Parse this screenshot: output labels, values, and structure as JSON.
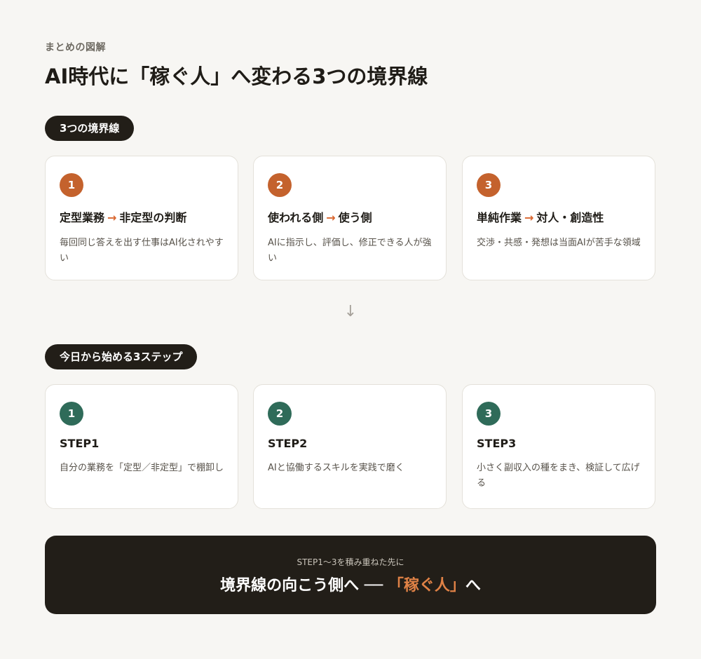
{
  "header": {
    "kicker": "まとめの図解",
    "title": "AI時代に「稼ぐ人」へ変わる3つの境界線"
  },
  "section1": {
    "label": "3つの境界線",
    "arrow": "→",
    "cards": [
      {
        "number": "1",
        "from": "定型業務",
        "to": "非定型の判断",
        "desc": "毎回同じ答えを出す仕事はAI化されやすい"
      },
      {
        "number": "2",
        "from": "使われる側",
        "to": "使う側",
        "desc": "AIに指示し、評価し、修正できる人が強い"
      },
      {
        "number": "3",
        "from": "単純作業",
        "to": "対人・創造性",
        "desc": "交渉・共感・発想は当面AIが苦手な領域"
      }
    ]
  },
  "flow_arrow": "↓",
  "section2": {
    "label": "今日から始める3ステップ",
    "cards": [
      {
        "number": "1",
        "title": "STEP1",
        "desc": "自分の業務を「定型／非定型」で棚卸し"
      },
      {
        "number": "2",
        "title": "STEP2",
        "desc": "AIと協働するスキルを実践で磨く"
      },
      {
        "number": "3",
        "title": "STEP3",
        "desc": "小さく副収入の種をまき、検証して広げる"
      }
    ]
  },
  "banner": {
    "sub": "STEP1〜3を積み重ねた先に",
    "main_prefix": "境界線の向こう側へ ── ",
    "main_accent": "「稼ぐ人」",
    "main_suffix": "へ"
  },
  "colors": {
    "accent_orange": "#c4622d",
    "accent_green": "#2f6b59",
    "dark": "#221e18",
    "background": "#f7f6f3"
  }
}
